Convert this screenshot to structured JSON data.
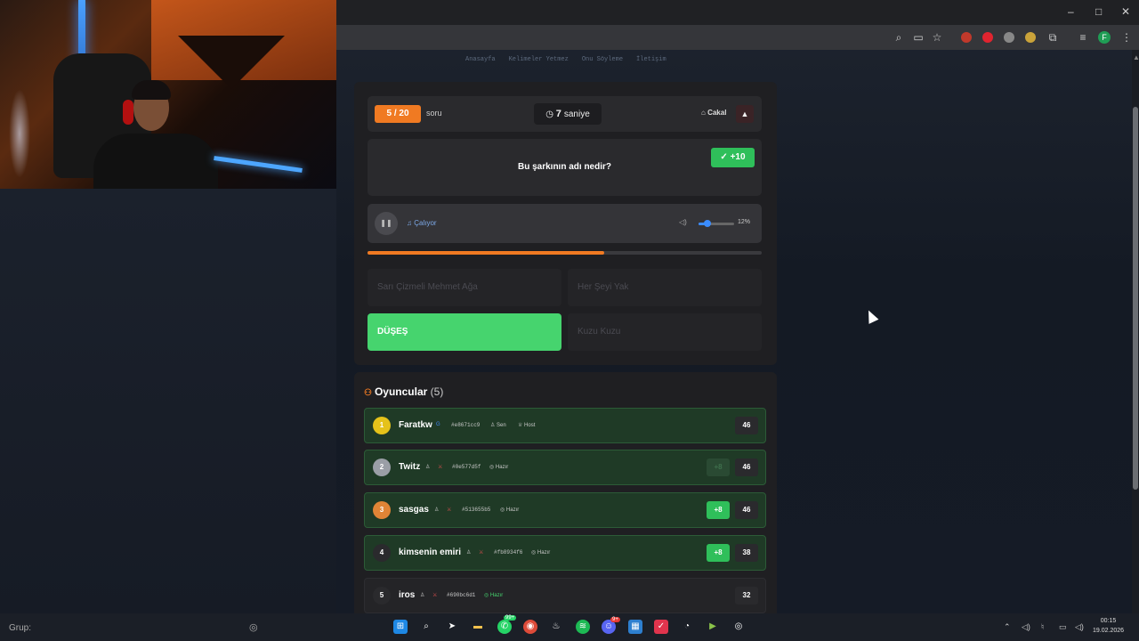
{
  "browser": {
    "window_controls": [
      "–",
      "□",
      "✕"
    ],
    "profile_initial": "F"
  },
  "nav": [
    "Anasayfa",
    "Kelimeler Yetmez",
    "Onu Söyleme",
    "İletişim"
  ],
  "game": {
    "question_counter": "5 / 20",
    "question_label": "soru",
    "timer_value": "7",
    "timer_unit": "saniye",
    "user_tag": "Cakal",
    "question": "Bu şarkının adı nedir?",
    "points": "+10",
    "player_status": "Çalıyor",
    "volume_percent": "12%",
    "volume_level": 0.12,
    "progress_fraction": 0.6,
    "answers": [
      "Sarı Çizmeli Mehmet Ağa",
      "Her Şeyi Yak",
      "DÜŞEŞ",
      "Kuzu Kuzu"
    ],
    "correct_answer_index": 2
  },
  "players": {
    "title": "Oyuncular",
    "count": "(5)",
    "list": [
      {
        "rank": "1",
        "name": "Faratkw",
        "id": "#e8671cc9",
        "tags": [
          "Sen",
          "Host"
        ],
        "gain": "",
        "score": "46",
        "rank_color": "#e5c21a"
      },
      {
        "rank": "2",
        "name": "Twitz",
        "id": "#0e577d5f",
        "tags": [
          "Hazır"
        ],
        "gain": "+8",
        "score": "46",
        "rank_color": "#9a9ea6"
      },
      {
        "rank": "3",
        "name": "sasgas",
        "id": "#513655b5",
        "tags": [
          "Hazır"
        ],
        "gain": "+8",
        "score": "46",
        "rank_color": "#e08436"
      },
      {
        "rank": "4",
        "name": "kimsenin emiri",
        "id": "#fb8934f6",
        "tags": [
          "Hazır"
        ],
        "gain": "+8",
        "score": "38",
        "rank_color": "#2a2a2d"
      },
      {
        "rank": "5",
        "name": "iros",
        "id": "#690bc6d1",
        "tags": [
          "Hazır"
        ],
        "gain": "",
        "score": "32",
        "rank_color": "#2a2a2d"
      }
    ]
  },
  "taskbar": {
    "search_label": "Grup:",
    "badge_whatsapp": "99+",
    "badge_discord": "9+",
    "time": "00:15",
    "date": "19.02.2026"
  }
}
